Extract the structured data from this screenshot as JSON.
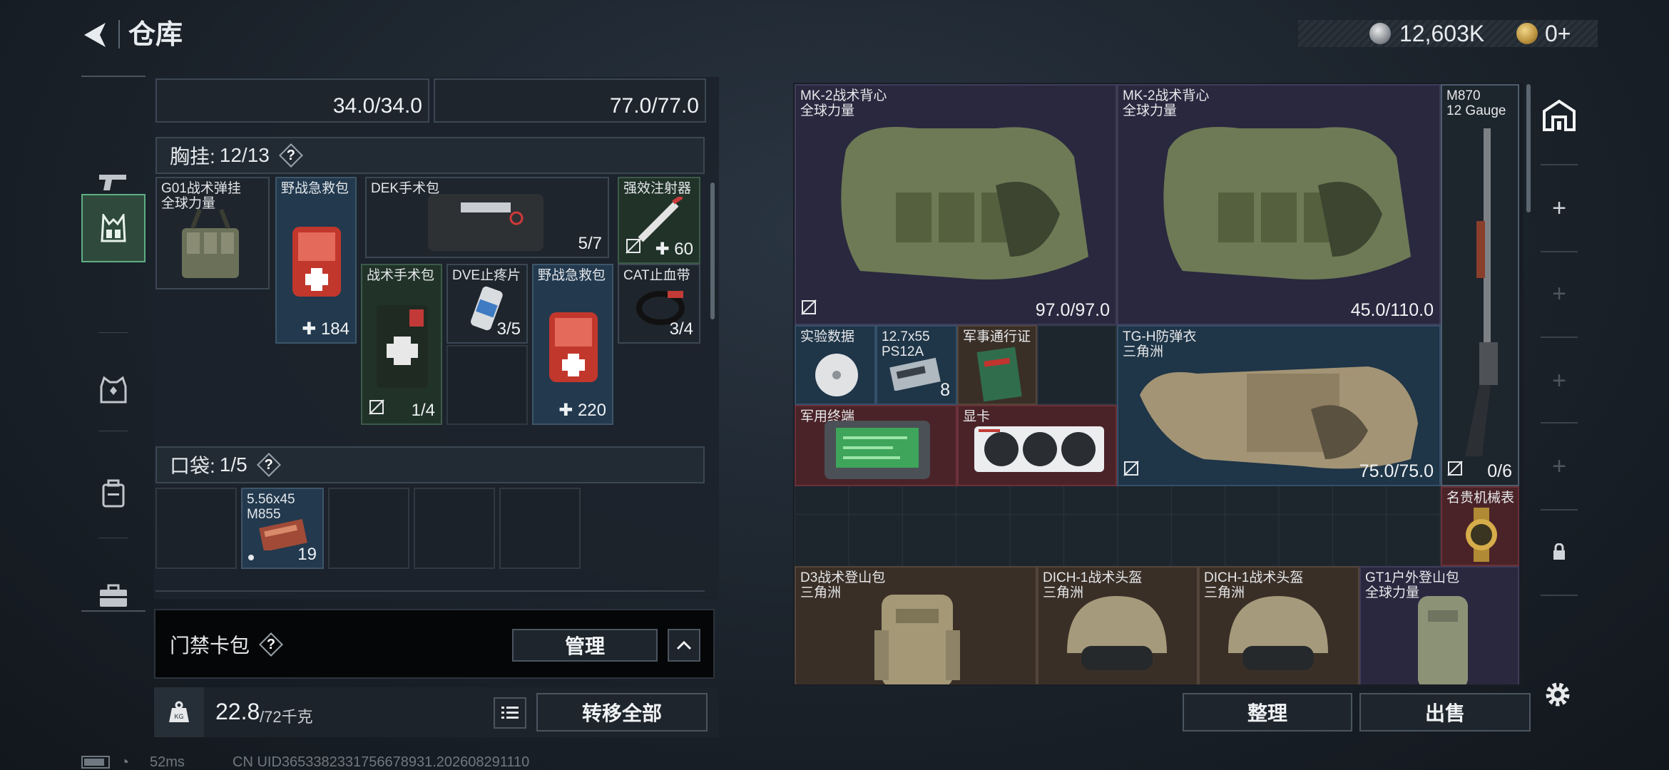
{
  "header": {
    "title": "仓库",
    "silver_amount": "12,603K",
    "gold_amount": "0+"
  },
  "left": {
    "top_slots": [
      {
        "value": "34.0/34.0"
      },
      {
        "value": "77.0/77.0"
      }
    ],
    "chest_rig": {
      "label": "胸挂:",
      "count": "12/13"
    },
    "rig_items": [
      {
        "name": "G01战术弹挂",
        "sub": "全球力量",
        "value": ""
      },
      {
        "name": "野战急救包",
        "value": "184"
      },
      {
        "name": "DEK手术包",
        "value": "5/7"
      },
      {
        "name": "强效注射器",
        "value": "60"
      },
      {
        "name": "战术手术包",
        "value": "1/4"
      },
      {
        "name": "DVE止疼片",
        "value": "3/5"
      },
      {
        "name": "野战急救包",
        "value": "220"
      },
      {
        "name": "CAT止血带",
        "value": "3/4"
      }
    ],
    "pocket": {
      "label": "口袋:",
      "count": "1/5",
      "item": {
        "name": "5.56x45",
        "sub": "M855",
        "value": "19"
      }
    },
    "keycard": {
      "label": "门禁卡包",
      "manage_label": "管理"
    },
    "weight": {
      "current": "22.8",
      "capacity": "/72千克",
      "unit_icon": "KG"
    },
    "transfer_all_label": "转移全部"
  },
  "right": {
    "items": [
      {
        "name": "MK-2战术背心",
        "sub": "全球力量",
        "value": "97.0/97.0"
      },
      {
        "name": "MK-2战术背心",
        "sub": "全球力量",
        "value": "45.0/110.0"
      },
      {
        "name": "M870",
        "sub": "12 Gauge",
        "value": "0/6"
      },
      {
        "name": "实验数据"
      },
      {
        "name": "12.7x55",
        "sub": "PS12A",
        "value": "8"
      },
      {
        "name": "军事通行证"
      },
      {
        "name": "TG-H防弹衣",
        "sub": "三角洲",
        "value": "75.0/75.0"
      },
      {
        "name": "军用终端"
      },
      {
        "name": "显卡"
      },
      {
        "name": "名贵机械表"
      },
      {
        "name": "D3战术登山包",
        "sub": "三角洲"
      },
      {
        "name": "DICH-1战术头盔",
        "sub": "三角洲"
      },
      {
        "name": "DICH-1战术头盔",
        "sub": "三角洲"
      },
      {
        "name": "GT1户外登山包",
        "sub": "全球力量"
      }
    ],
    "sort_label": "整理",
    "sell_label": "出售"
  },
  "status": {
    "ping": "52ms",
    "uid": "CN UID3653382331756678931.202608291110"
  },
  "colors": {
    "accent_green": "#5fae84",
    "slot_blue": "#22394e",
    "slot_purple": "#29283f",
    "slot_red": "#4a2328",
    "slot_brown": "#3a2f27"
  }
}
